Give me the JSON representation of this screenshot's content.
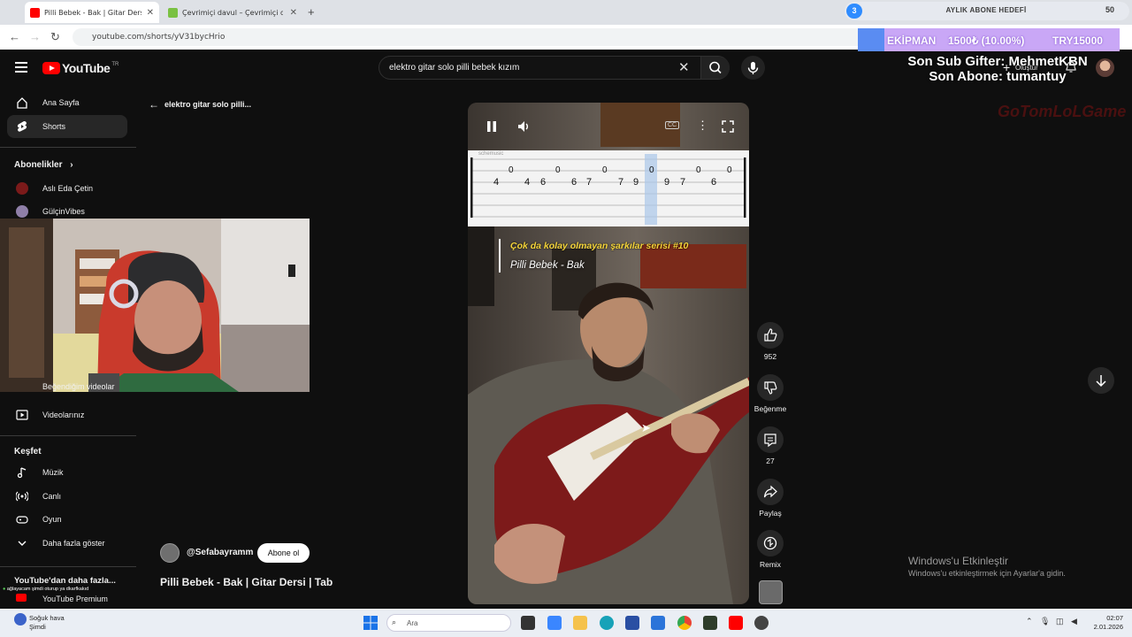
{
  "browser": {
    "tabs": [
      {
        "title": "Pilli Bebek - Bak | Gitar Ders",
        "active": true
      },
      {
        "title": "Çevrimiçi davul – Çevrimiçi davu",
        "active": false
      }
    ],
    "url": "youtube.com/shorts/yV31bycHrio"
  },
  "stream_overlay": {
    "goal_badge": "3",
    "goal_title": "AYLIK ABONE HEDEFİ",
    "goal_count": "50",
    "equipment_label": "EKİPMAN",
    "equipment_progress": "1500₺ (10.00%)",
    "equipment_target": "TRY15000",
    "equipment_progress_fraction": 0.1,
    "sub_gifter": "Son Sub Gifter: MehmetKBN",
    "last_sub": "Son Abone: tumantuy",
    "create_label": "Oluştur",
    "brand": "GoTomLoLGame",
    "chat_line": "ağlayacam şimdi oturup ya dkarfkakıd"
  },
  "header": {
    "logo_text": "YouTube",
    "logo_country": "TR",
    "search_value": "elektro gitar solo pilli bebek kızım"
  },
  "sidebar": {
    "items": [
      {
        "label": "Ana Sayfa"
      },
      {
        "label": "Shorts"
      }
    ],
    "subscriptions_heading": "Abonelikler",
    "subscriptions": [
      {
        "label": "Aslı Eda Çetin"
      },
      {
        "label": "GülçinVibes"
      }
    ],
    "you_items": [
      {
        "label": "Beğendiğim videolar"
      },
      {
        "label": "Videolarınız"
      }
    ],
    "explore_heading": "Keşfet",
    "explore": [
      {
        "label": "Müzik"
      },
      {
        "label": "Canlı"
      },
      {
        "label": "Oyun"
      },
      {
        "label": "Daha fazla göster"
      }
    ],
    "more_heading": "YouTube'dan daha fazla...",
    "premium": "YouTube Premium"
  },
  "main": {
    "back_label": "elektro gitar solo pilli...",
    "video": {
      "tab_header": "schemusic",
      "tab_numbers": [
        "0",
        "0",
        "0",
        "0",
        "0",
        "0",
        "4",
        "4",
        "6",
        "6",
        "7",
        "7",
        "9",
        "9",
        "7",
        "6"
      ],
      "overlay_line1": "Çok da kolay olmayan şarkılar serisi #10",
      "overlay_line2": "Pilli Bebek - Bak"
    },
    "actions": {
      "likes": "952",
      "dislike_label": "Beğenme",
      "comments": "27",
      "share_label": "Paylaş",
      "remix_label": "Remix"
    },
    "channel": "@Sefabayramm",
    "subscribe_label": "Abone ol",
    "title": "Pilli Bebek - Bak | Gitar Dersi | Tab"
  },
  "windows": {
    "activate_title": "Windows'u Etkinleştir",
    "activate_subtitle": "Windows'u etkinleştirmek için Ayarlar'a gidin.",
    "weather": "Soğuk hava",
    "weather_sub": "Şimdi",
    "search_placeholder": "Ara",
    "time": "02:07",
    "date": "2.01.2026"
  },
  "colors": {
    "accent": "#ff0000",
    "overlay_yellow": "#f4d43a",
    "equipment_bg": "#c9a7f6"
  }
}
